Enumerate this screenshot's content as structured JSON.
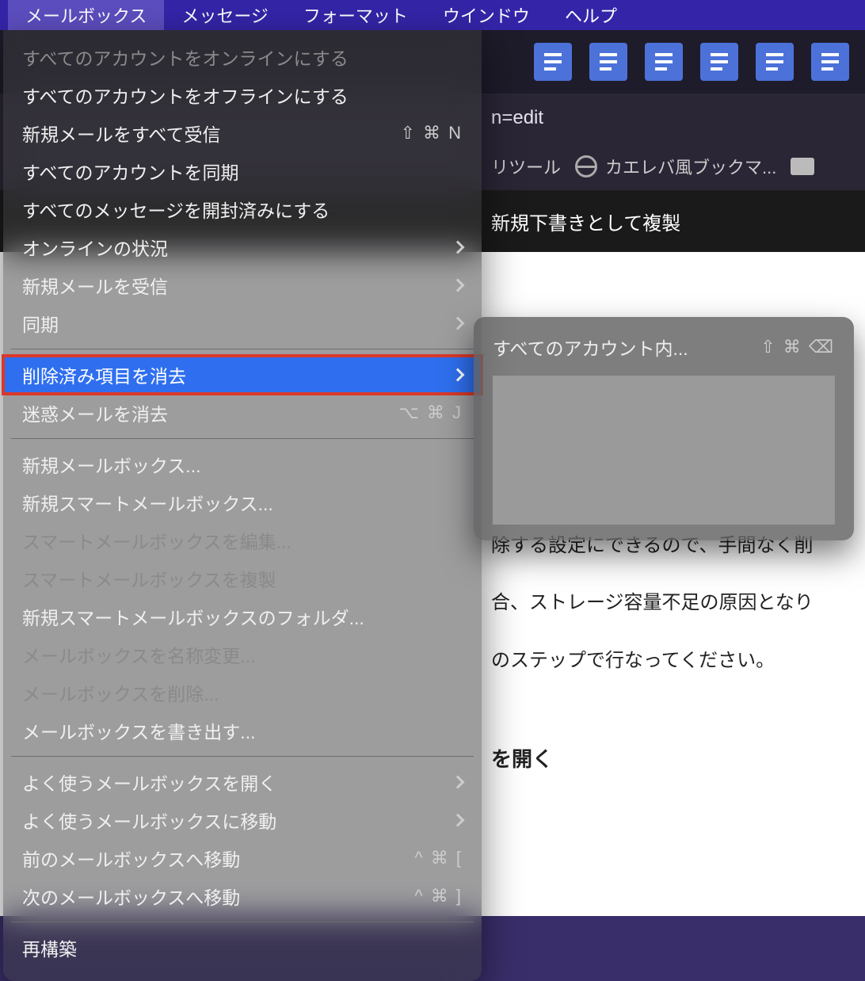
{
  "menubar": {
    "items": [
      "メールボックス",
      "メッセージ",
      "フォーマット",
      "ウインドウ",
      "ヘルプ"
    ],
    "active_index": 0
  },
  "urlbar_fragment": "n=edit",
  "bookmarks": {
    "tool": "リツール",
    "kaereba": "カエレバ風ブックマ..."
  },
  "page_title_fragment": "新規下書きとして複製",
  "dropdown": {
    "groups": [
      [
        {
          "label": "すべてのアカウントをオンラインにする",
          "disabled": true
        },
        {
          "label": "すべてのアカウントをオフラインにする"
        },
        {
          "label": "新規メールをすべて受信",
          "shortcut": "⇧ ⌘ N"
        },
        {
          "label": "すべてのアカウントを同期"
        },
        {
          "label": "すべてのメッセージを開封済みにする"
        },
        {
          "label": "オンラインの状況",
          "chevron": true
        },
        {
          "label": "新規メールを受信",
          "chevron": true
        },
        {
          "label": "同期",
          "chevron": true
        }
      ],
      [
        {
          "label": "削除済み項目を消去",
          "chevron": true,
          "highlighted": true,
          "boxed": true
        },
        {
          "label": "迷惑メールを消去",
          "shortcut": "⌥ ⌘ J"
        }
      ],
      [
        {
          "label": "新規メールボックス..."
        },
        {
          "label": "新規スマートメールボックス..."
        },
        {
          "label": "スマートメールボックスを編集...",
          "disabled": true
        },
        {
          "label": "スマートメールボックスを複製",
          "disabled": true
        },
        {
          "label": "新規スマートメールボックスのフォルダ..."
        },
        {
          "label": "メールボックスを名称変更...",
          "disabled": true
        },
        {
          "label": "メールボックスを削除...",
          "disabled": true
        },
        {
          "label": "メールボックスを書き出す..."
        }
      ],
      [
        {
          "label": "よく使うメールボックスを開く",
          "chevron": true
        },
        {
          "label": "よく使うメールボックスに移動",
          "chevron": true
        },
        {
          "label": "前のメールボックスへ移動",
          "shortcut": "^ ⌘  ["
        },
        {
          "label": "次のメールボックスへ移動",
          "shortcut": "^ ⌘  ]"
        }
      ],
      [
        {
          "label": "再構築"
        }
      ]
    ]
  },
  "submenu": {
    "label": "すべてのアカウント内...",
    "shortcut": "⇧ ⌘ ⌫"
  },
  "content": {
    "line1": "除する設定にできるので、手間なく削",
    "line2": "合、ストレージ容量不足の原因となり",
    "line3": "のステップで行なってください。",
    "h3": "を開く"
  }
}
